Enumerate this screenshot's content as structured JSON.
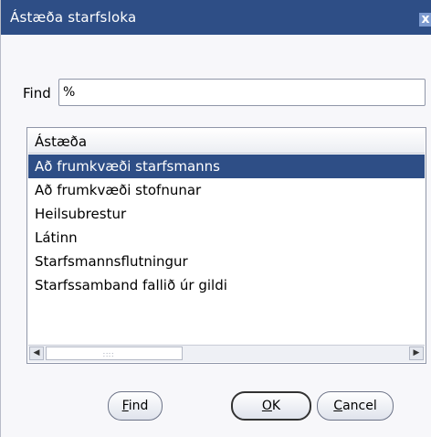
{
  "dialog": {
    "title": "Ástæða starfsloka",
    "close_glyph": "x"
  },
  "find": {
    "label": "Find",
    "value": "%"
  },
  "list": {
    "header": "Ástæða",
    "rows": [
      "Að frumkvæði starfsmanns",
      "Að frumkvæði stofnunar",
      "Heilsubrestur",
      "Látinn",
      "Starfsmannsflutningur",
      "Starfssamband fallið úr gildi"
    ],
    "selected_index": 0
  },
  "buttons": {
    "find": {
      "mnemonic": "F",
      "rest": "ind"
    },
    "ok": {
      "mnemonic": "O",
      "rest": "K"
    },
    "cancel": {
      "mnemonic": "C",
      "rest": "ancel"
    }
  },
  "icons": {
    "scroll_left": "left-arrow-icon",
    "scroll_right": "right-arrow-icon"
  }
}
